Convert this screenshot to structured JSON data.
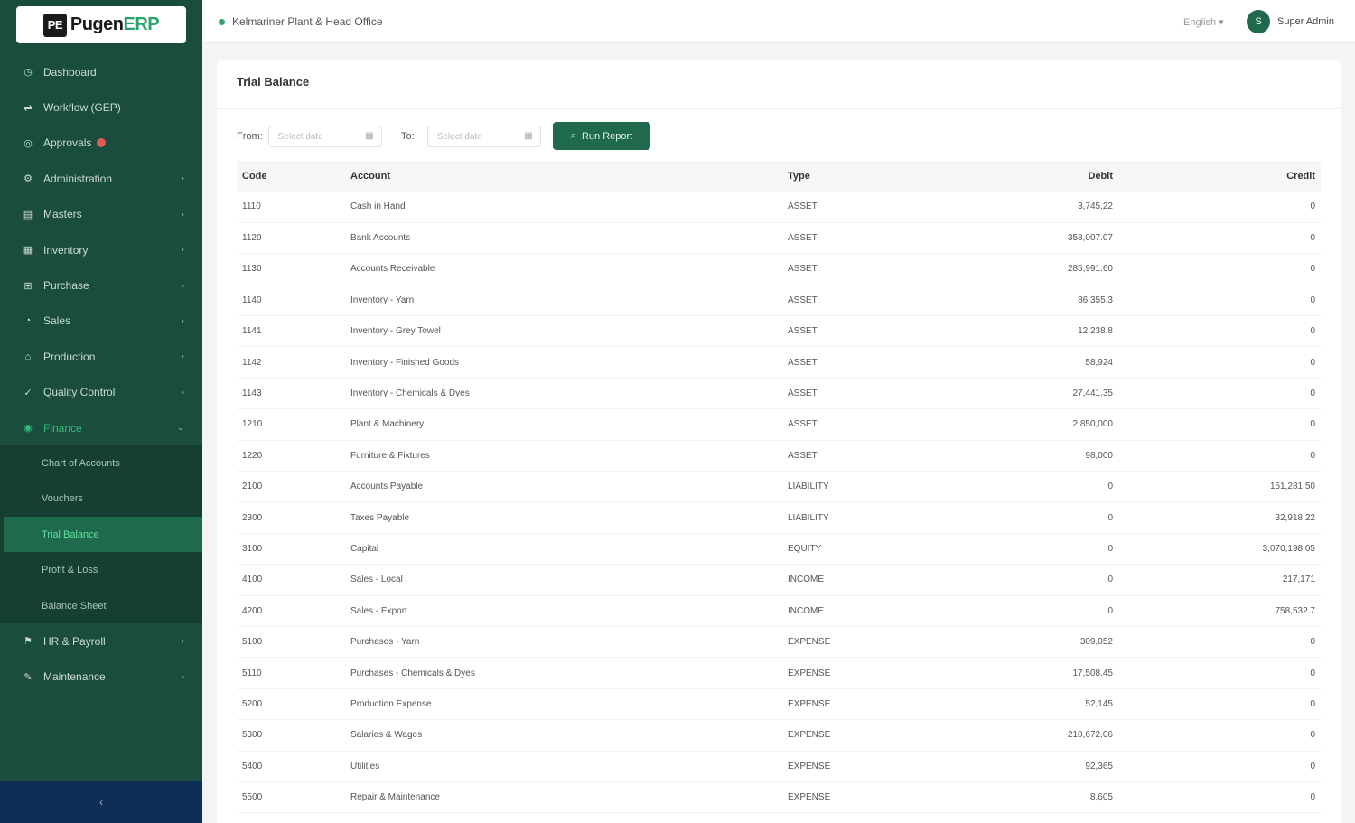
{
  "brand": {
    "logo_mark": "PE",
    "name_a": "Pugen",
    "name_b": "ERP"
  },
  "sidebar": {
    "items": [
      {
        "label": "Dashboard",
        "icon": "dashboard-icon",
        "glyph": "◷"
      },
      {
        "label": "Workflow (GEP)",
        "icon": "workflow-icon",
        "glyph": "⇌"
      },
      {
        "label": "Approvals",
        "icon": "approvals-icon",
        "glyph": "◎"
      },
      {
        "label": "Administration",
        "icon": "admin-icon",
        "glyph": "⚙"
      },
      {
        "label": "Masters",
        "icon": "masters-icon",
        "glyph": "▤"
      },
      {
        "label": "Inventory",
        "icon": "inventory-icon",
        "glyph": "▦"
      },
      {
        "label": "Purchase",
        "icon": "purchase-icon",
        "glyph": "⊞"
      },
      {
        "label": "Sales",
        "icon": "sales-icon",
        "glyph": "◔"
      },
      {
        "label": "Production",
        "icon": "production-icon",
        "glyph": "⌂"
      },
      {
        "label": "Quality Control",
        "icon": "quality-icon",
        "glyph": "✓"
      },
      {
        "label": "Finance",
        "icon": "finance-icon",
        "glyph": "◉"
      }
    ],
    "finance_sub": [
      {
        "label": "Chart of Accounts"
      },
      {
        "label": "Vouchers"
      },
      {
        "label": "Trial Balance"
      },
      {
        "label": "Profit & Loss"
      },
      {
        "label": "Balance Sheet"
      }
    ],
    "after_items": [
      {
        "label": "HR & Payroll",
        "icon": "hr-icon",
        "glyph": "⚑"
      },
      {
        "label": "Maintenance",
        "icon": "maintenance-icon",
        "glyph": "✎"
      }
    ],
    "collapse_glyph": "‹"
  },
  "topbar": {
    "company": "Kelmariner Plant & Head Office",
    "language": "English ▾",
    "avatar_initial": "S",
    "user_name": "Super Admin"
  },
  "page": {
    "title": "Trial Balance",
    "from_label": "From",
    "to_label": "To",
    "from_placeholder": "Select date",
    "to_placeholder": "Select date",
    "run_button": "Run Report"
  },
  "table": {
    "headers": {
      "code": "Code",
      "account": "Account",
      "type": "Type",
      "debit": "Debit",
      "credit": "Credit"
    },
    "rows": [
      {
        "code": "1110",
        "account": "Cash in Hand",
        "type": "ASSET",
        "debit": "3,745.22",
        "credit": "0"
      },
      {
        "code": "1120",
        "account": "Bank Accounts",
        "type": "ASSET",
        "debit": "358,007.07",
        "credit": "0"
      },
      {
        "code": "1130",
        "account": "Accounts Receivable",
        "type": "ASSET",
        "debit": "285,991.60",
        "credit": "0"
      },
      {
        "code": "1140",
        "account": "Inventory - Yarn",
        "type": "ASSET",
        "debit": "86,355.3",
        "credit": "0"
      },
      {
        "code": "1141",
        "account": "Inventory - Grey Towel",
        "type": "ASSET",
        "debit": "12,238.8",
        "credit": "0"
      },
      {
        "code": "1142",
        "account": "Inventory - Finished Goods",
        "type": "ASSET",
        "debit": "58,924",
        "credit": "0"
      },
      {
        "code": "1143",
        "account": "Inventory - Chemicals & Dyes",
        "type": "ASSET",
        "debit": "27,441.35",
        "credit": "0"
      },
      {
        "code": "1210",
        "account": "Plant & Machinery",
        "type": "ASSET",
        "debit": "2,850,000",
        "credit": "0"
      },
      {
        "code": "1220",
        "account": "Furniture & Fixtures",
        "type": "ASSET",
        "debit": "98,000",
        "credit": "0"
      },
      {
        "code": "2100",
        "account": "Accounts Payable",
        "type": "LIABILITY",
        "debit": "0",
        "credit": "151,281.50"
      },
      {
        "code": "2300",
        "account": "Taxes Payable",
        "type": "LIABILITY",
        "debit": "0",
        "credit": "32,918.22"
      },
      {
        "code": "3100",
        "account": "Capital",
        "type": "EQUITY",
        "debit": "0",
        "credit": "3,070,198.05"
      },
      {
        "code": "4100",
        "account": "Sales - Local",
        "type": "INCOME",
        "debit": "0",
        "credit": "217,171"
      },
      {
        "code": "4200",
        "account": "Sales - Export",
        "type": "INCOME",
        "debit": "0",
        "credit": "758,532.7"
      },
      {
        "code": "5100",
        "account": "Purchases - Yarn",
        "type": "EXPENSE",
        "debit": "309,052",
        "credit": "0"
      },
      {
        "code": "5110",
        "account": "Purchases - Chemicals & Dyes",
        "type": "EXPENSE",
        "debit": "17,508.45",
        "credit": "0"
      },
      {
        "code": "5200",
        "account": "Production Expense",
        "type": "EXPENSE",
        "debit": "52,145",
        "credit": "0"
      },
      {
        "code": "5300",
        "account": "Salaries & Wages",
        "type": "EXPENSE",
        "debit": "210,672.06",
        "credit": "0"
      },
      {
        "code": "5400",
        "account": "Utilities",
        "type": "EXPENSE",
        "debit": "92,365",
        "credit": "0"
      },
      {
        "code": "5500",
        "account": "Repair & Maintenance",
        "type": "EXPENSE",
        "debit": "8,605",
        "credit": "0"
      }
    ]
  },
  "colors": {
    "sidebar": "#1b4d3e",
    "accent": "#1f6a4c",
    "active_text": "#2fbf7a",
    "footer": "#0e2f55"
  }
}
